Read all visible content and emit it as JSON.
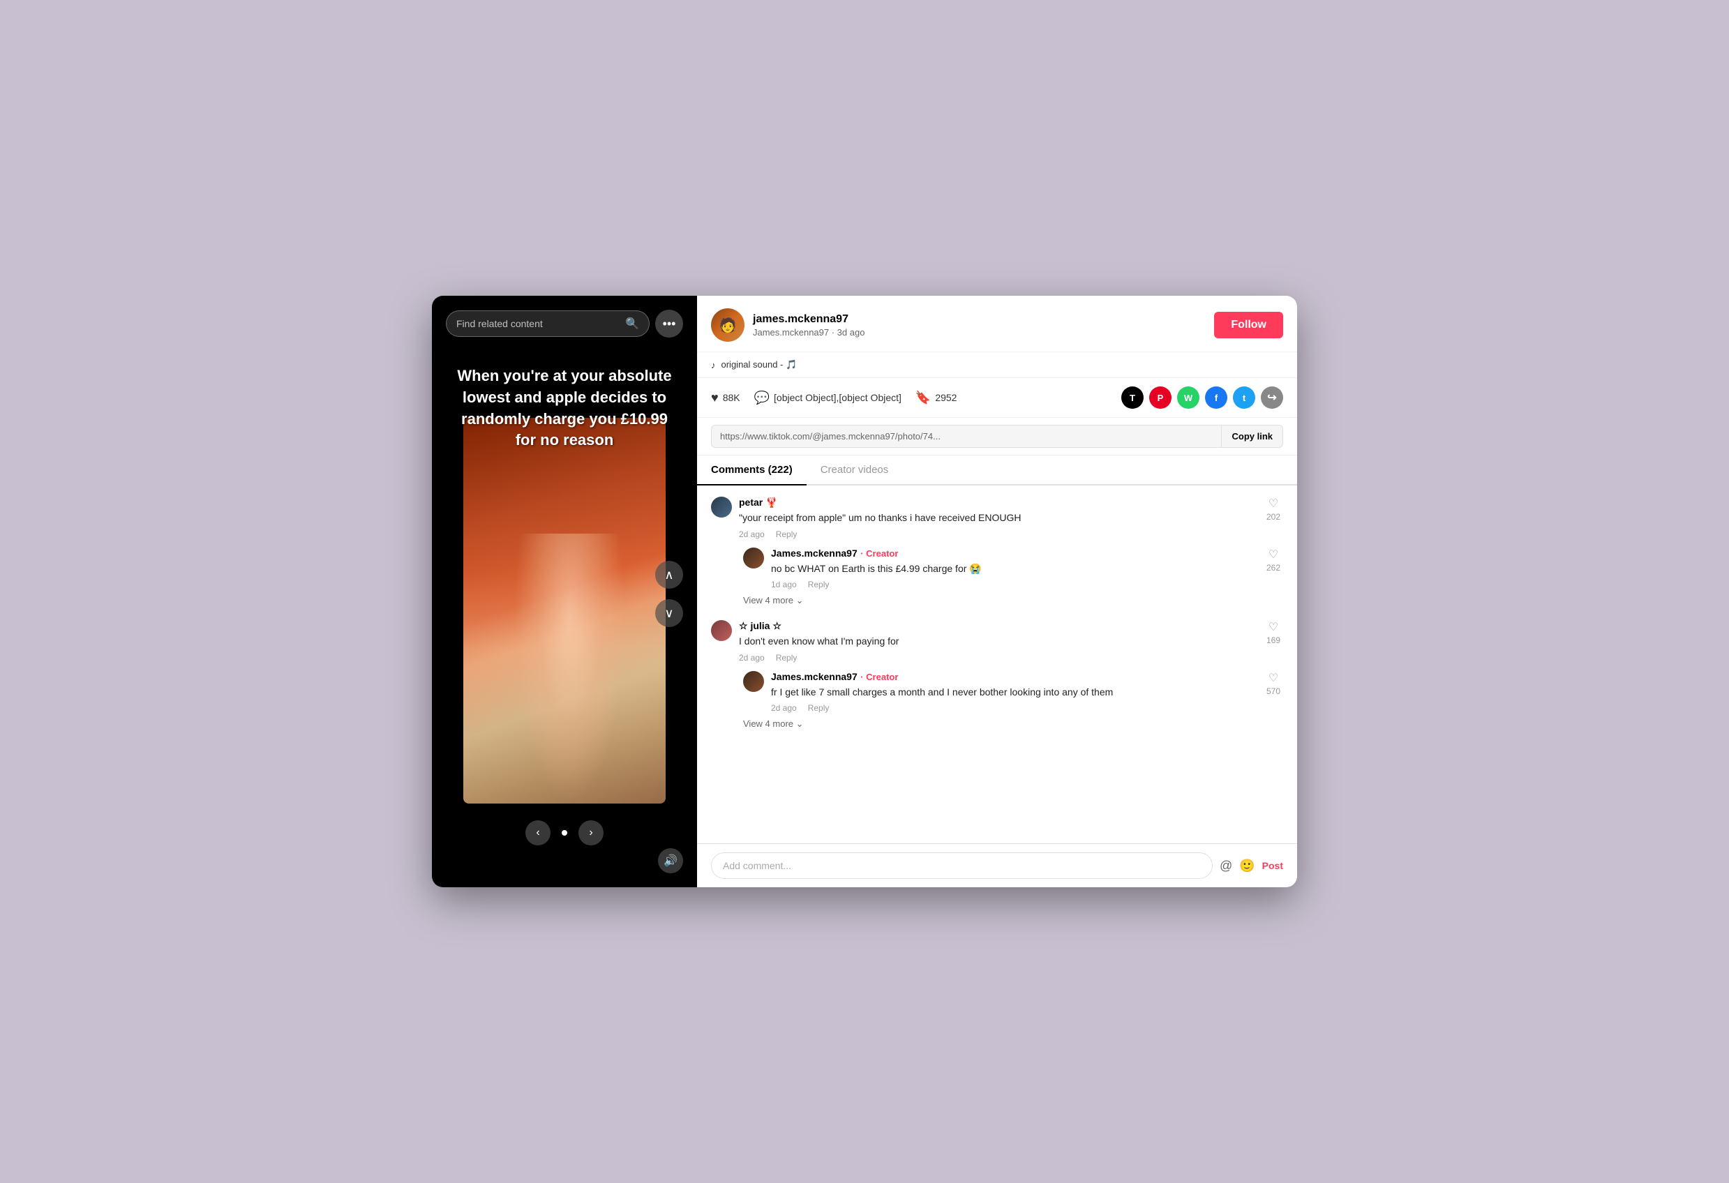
{
  "app": {
    "bg_color": "#c8c0d0"
  },
  "left": {
    "search_placeholder": "Find related content",
    "overlay_text": "When you're at your absolute lowest and apple decides to randomly charge you £10.99 for no reason"
  },
  "right": {
    "username": "james.mckenna97",
    "username_sub": "James.mckenna97 · 3d ago",
    "follow_label": "Follow",
    "sound": "original sound - 🎵",
    "likes": "88K",
    "comments": [
      {
        "user": "petar 🦞",
        "text": "\"your receipt from apple\" um no thanks i have received ENOUGH",
        "time": "2d ago",
        "likes": "202",
        "replies": [
          {
            "user": "James.mckenna97",
            "creator": true,
            "text": "no bc WHAT on Earth is this £4.99 charge for 😭",
            "time": "1d ago",
            "likes": "262"
          }
        ],
        "more_replies": 4
      },
      {
        "user": "☆ julia ☆",
        "text": "I don't even know what I'm paying for",
        "time": "2d ago",
        "likes": "169",
        "replies": [
          {
            "user": "James.mckenna97",
            "creator": true,
            "text": "fr I get like 7 small charges a month and I never bother looking into any of them",
            "time": "2d ago",
            "likes": "570"
          }
        ],
        "more_replies": 4
      }
    ],
    "bookmarks": "2952",
    "link_url": "https://www.tiktok.com/@james.mckenna97/photo/74...",
    "copy_link_label": "Copy link",
    "tabs": [
      {
        "label": "Comments (222)",
        "active": true
      },
      {
        "label": "Creator videos",
        "active": false
      }
    ],
    "comment_placeholder": "Add comment...",
    "post_label": "Post"
  }
}
